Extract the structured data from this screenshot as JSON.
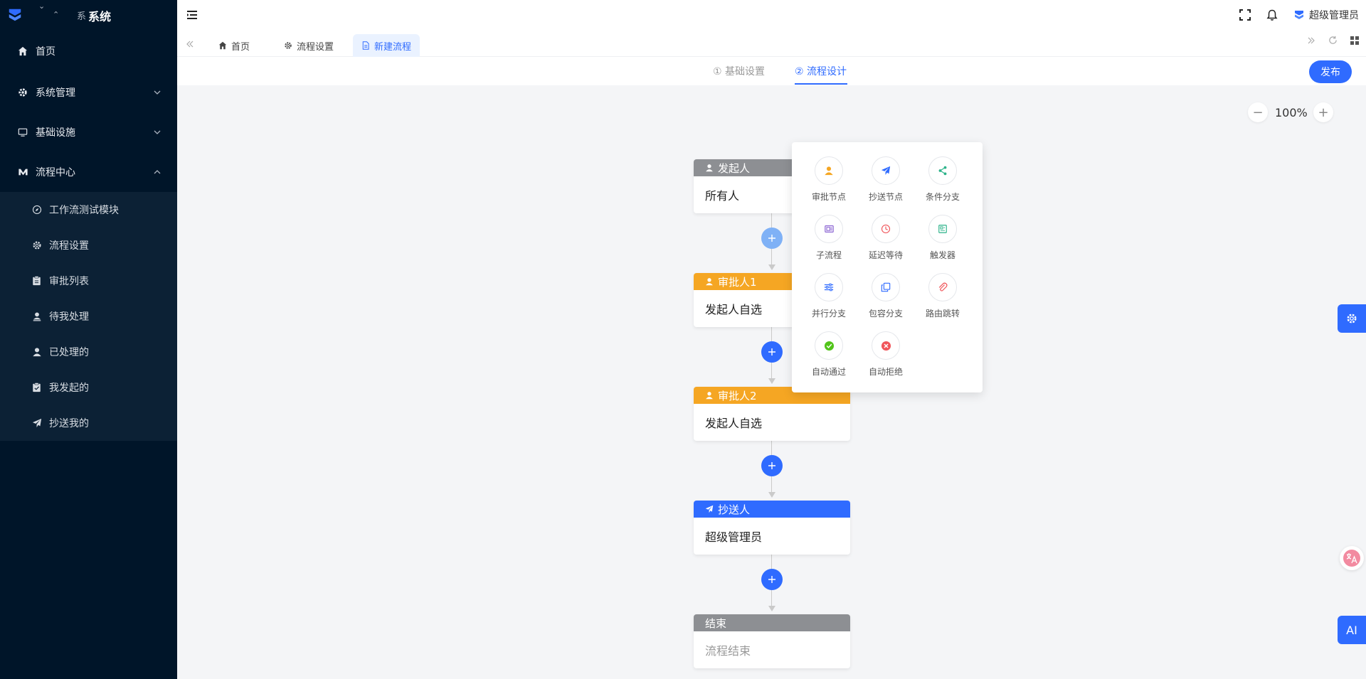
{
  "app": {
    "logo_small": "系",
    "title": "系统"
  },
  "sidebar": {
    "items": [
      {
        "label": "首页"
      },
      {
        "label": "系统管理"
      },
      {
        "label": "基础设施"
      },
      {
        "label": "流程中心"
      }
    ],
    "sub_items": [
      {
        "label": "工作流测试模块"
      },
      {
        "label": "流程设置"
      },
      {
        "label": "审批列表"
      },
      {
        "label": "待我处理"
      },
      {
        "label": "已处理的"
      },
      {
        "label": "我发起的"
      },
      {
        "label": "抄送我的"
      }
    ]
  },
  "header": {
    "user_name": "超级管理员"
  },
  "tabs": [
    {
      "label": "首页"
    },
    {
      "label": "流程设置"
    },
    {
      "label": "新建流程"
    }
  ],
  "steps": [
    {
      "label": "① 基础设置"
    },
    {
      "label": "② 流程设计"
    }
  ],
  "publish_label": "发布",
  "zoom": {
    "value": "100%",
    "minus": "−",
    "plus": "+"
  },
  "flow": {
    "nodes": [
      {
        "title": "发起人",
        "body": "所有人",
        "color": "#8d8f93"
      },
      {
        "title": "审批人1",
        "body": "发起人自选",
        "color": "#f5a623"
      },
      {
        "title": "审批人2",
        "body": "发起人自选",
        "color": "#f5a623"
      },
      {
        "title": "抄送人",
        "body": "超级管理员",
        "color": "#2f6bff"
      },
      {
        "title": "结束",
        "body": "流程结束",
        "color": "#8d8f93"
      }
    ]
  },
  "popover": {
    "items": [
      {
        "label": "审批节点",
        "icon": "approver-icon",
        "color": "#f5a623"
      },
      {
        "label": "抄送节点",
        "icon": "send-icon",
        "color": "#2f6bff"
      },
      {
        "label": "条件分支",
        "icon": "share-icon",
        "color": "#2db38a"
      },
      {
        "label": "子流程",
        "icon": "subprocess-icon",
        "color": "#8a63d2"
      },
      {
        "label": "延迟等待",
        "icon": "clock-icon",
        "color": "#f0565b"
      },
      {
        "label": "触发器",
        "icon": "trigger-icon",
        "color": "#2db38a"
      },
      {
        "label": "并行分支",
        "icon": "sliders-icon",
        "color": "#2f6bff"
      },
      {
        "label": "包容分支",
        "icon": "copy-icon",
        "color": "#2f6bff"
      },
      {
        "label": "路由跳转",
        "icon": "paperclip-icon",
        "color": "#f0565b"
      },
      {
        "label": "自动通过",
        "icon": "check-circle-icon",
        "color": "#52c41a"
      },
      {
        "label": "自动拒绝",
        "icon": "close-circle-icon",
        "color": "#f0565b"
      }
    ]
  },
  "floats": {
    "ai_label": "AI"
  }
}
